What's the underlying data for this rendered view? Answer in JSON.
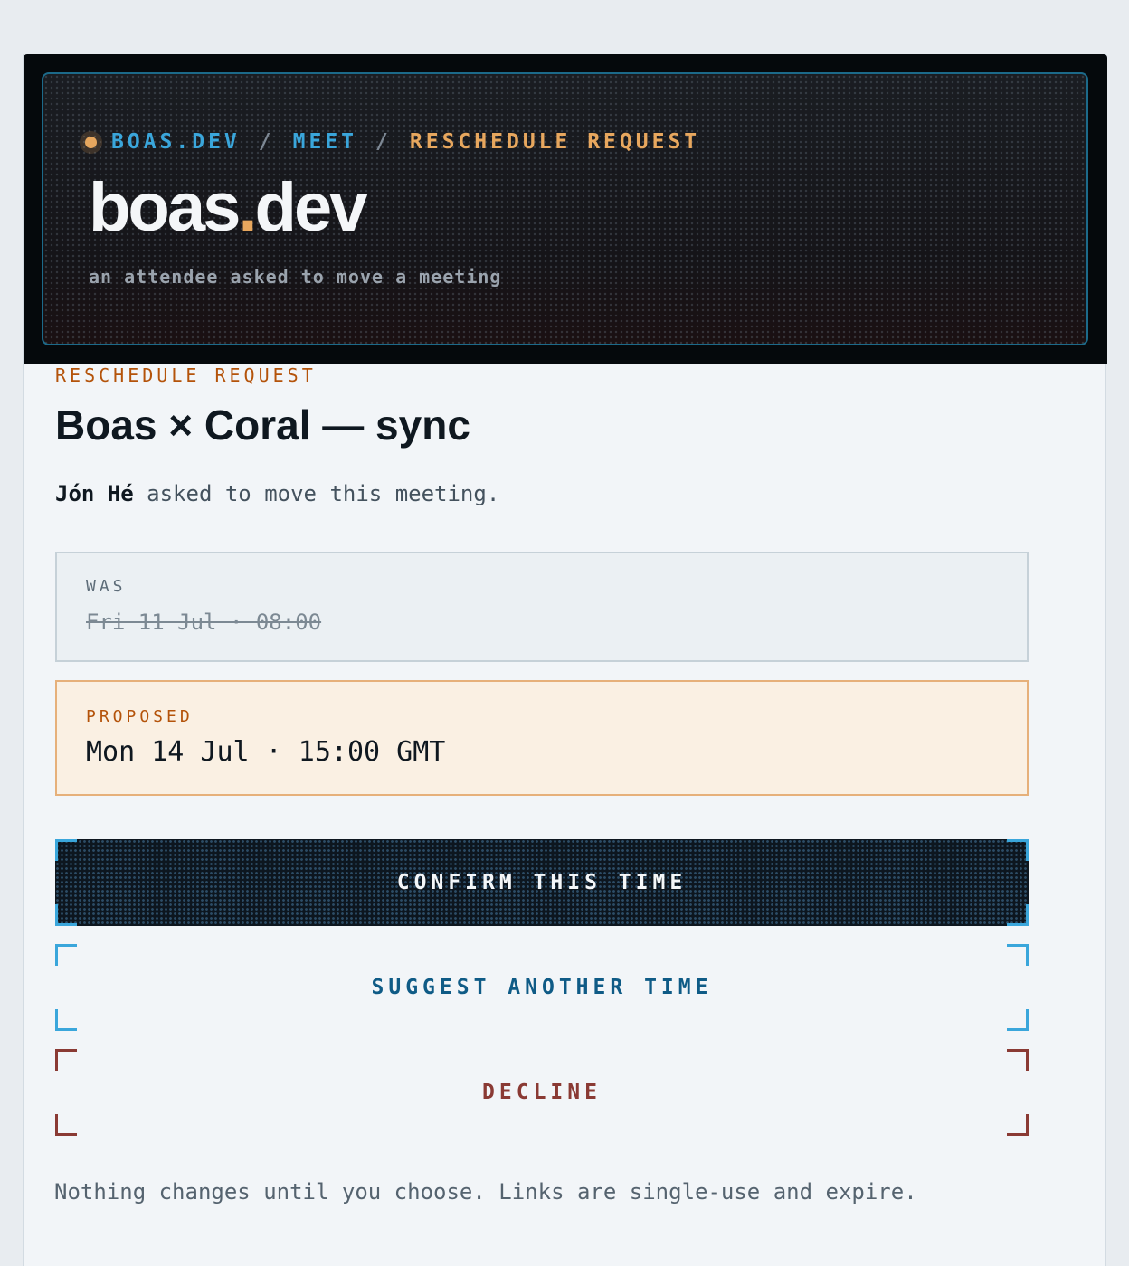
{
  "header": {
    "breadcrumb": [
      "BOAS.DEV",
      "/",
      "MEET",
      "/",
      "RESCHEDULE REQUEST"
    ],
    "logo_main": "boas",
    "logo_dot": ".",
    "logo_tail": "dev",
    "tagline": "an attendee asked to move a meeting"
  },
  "main": {
    "kicker": "RESCHEDULE REQUEST",
    "title": "Boas × Coral — sync",
    "requester_name": "Jón Hé",
    "requester_text": " asked to move this meeting."
  },
  "was": {
    "label": "WAS",
    "value": "Fri 11 Jul · 08:00"
  },
  "proposed": {
    "label": "PROPOSED",
    "value": "Mon 14 Jul · 15:00 GMT"
  },
  "actions": {
    "confirm_label": "CONFIRM THIS TIME",
    "suggest_label": "SUGGEST ANOTHER TIME",
    "decline_label": "DECLINE"
  },
  "footnote": "Nothing changes until you choose. Links are single-use and expire.",
  "colors": {
    "accent_blue": "#3aa6db",
    "accent_orange": "#e7a75e",
    "kicker_orange": "#b4530a",
    "decline_red": "#8a3a34"
  }
}
